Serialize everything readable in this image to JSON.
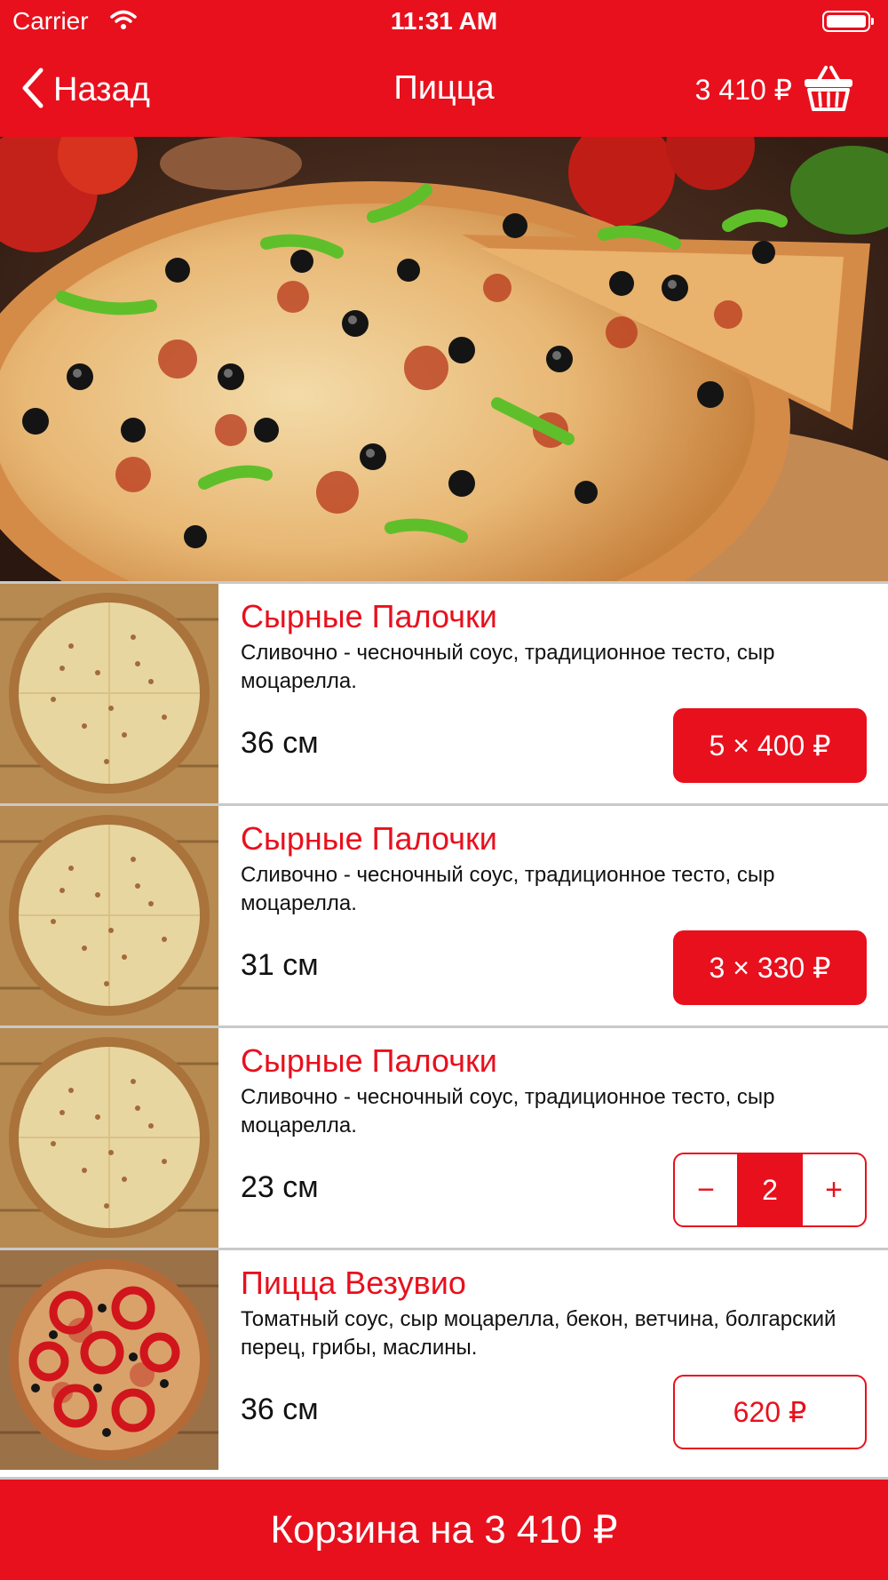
{
  "status_bar": {
    "carrier": "Carrier",
    "time": "11:31 AM",
    "icons": [
      "wifi-icon",
      "battery-icon"
    ]
  },
  "nav": {
    "back_label": "Назад",
    "title": "Пицца",
    "cart_total": "3 410 ₽",
    "cart_icon": "basket-icon"
  },
  "hero": {
    "icon": "pizza-photo"
  },
  "products": [
    {
      "name": "Сырные Палочки",
      "description": "Сливочно - чесночный соус, традиционное тесто, сыр моцарелла.",
      "size": "36 см",
      "button_type": "filled",
      "price_label": "5 × 400 ₽",
      "thumb": "cheese"
    },
    {
      "name": "Сырные Палочки",
      "description": "Сливочно - чесночный соус, традиционное тесто, сыр моцарелла.",
      "size": "31 см",
      "button_type": "filled",
      "price_label": "3 × 330 ₽",
      "thumb": "cheese"
    },
    {
      "name": "Сырные Палочки",
      "description": "Сливочно - чесночный соус, традиционное тесто, сыр моцарелла.",
      "size": "23 см",
      "button_type": "stepper",
      "stepper": {
        "minus": "−",
        "value": "2",
        "plus": "+"
      },
      "thumb": "cheese"
    },
    {
      "name": "Пицца Везувио",
      "description": "Томатный соус, сыр моцарелла, бекон, ветчина, болгарский перец, грибы, маслины.",
      "size": "36 см",
      "button_type": "outline",
      "price_label": "620 ₽",
      "thumb": "vesuvio"
    }
  ],
  "bottom_bar": {
    "label": "Корзина на 3 410 ₽"
  },
  "colors": {
    "accent": "#e8101d",
    "separator": "#c9c9c9"
  }
}
